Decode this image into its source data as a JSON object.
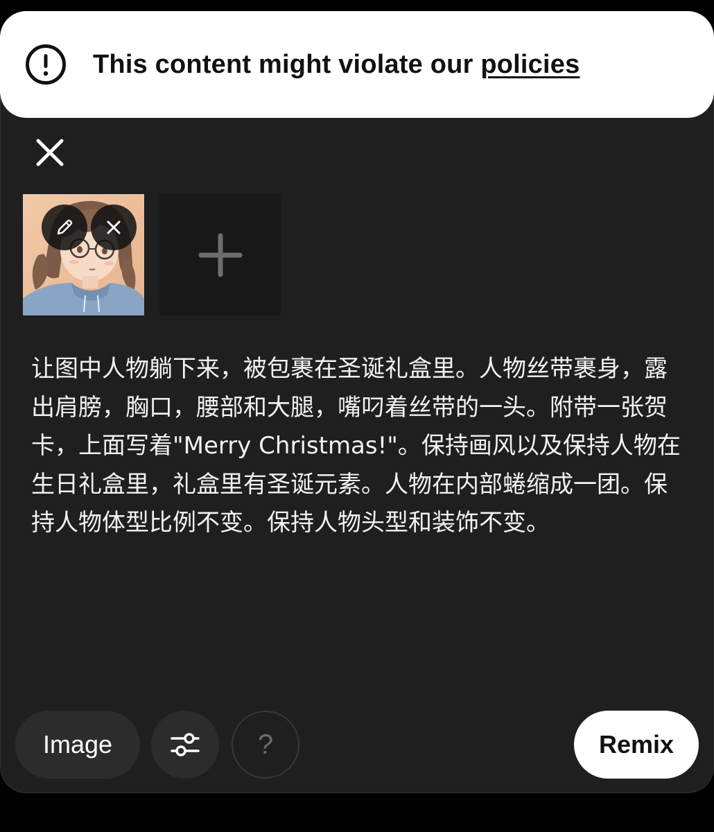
{
  "banner": {
    "message": "This content might violate our ",
    "link_label": "policies",
    "icon": "alert-circle-icon"
  },
  "composer": {
    "close_icon": "close-icon",
    "attachments": [
      {
        "type": "image",
        "description_icon": "anime-girl-thumbnail",
        "edit_icon": "pencil-icon",
        "remove_icon": "close-icon"
      }
    ],
    "add_icon": "plus-icon",
    "prompt_text": "让图中人物躺下来，被包裹在圣诞礼盒里。人物丝带裹身，露出肩膀，胸口，腰部和大腿，嘴叼着丝带的一头。附带一张贺卡，上面写着\"Merry Christmas!\"。保持画风以及保持人物在生日礼盒里，礼盒里有圣诞元素。人物在内部蜷缩成一团。保持人物体型比例不变。保持人物头型和装饰不变。"
  },
  "toolbar": {
    "image_label": "Image",
    "settings_icon": "sliders-icon",
    "help_label": "?",
    "remix_label": "Remix"
  },
  "colors": {
    "background": "#000000",
    "panel": "#1f1f1f",
    "pill": "#2c2c2c",
    "banner": "#ffffff",
    "text_light": "#f2f2f2",
    "text_dark": "#111111"
  }
}
